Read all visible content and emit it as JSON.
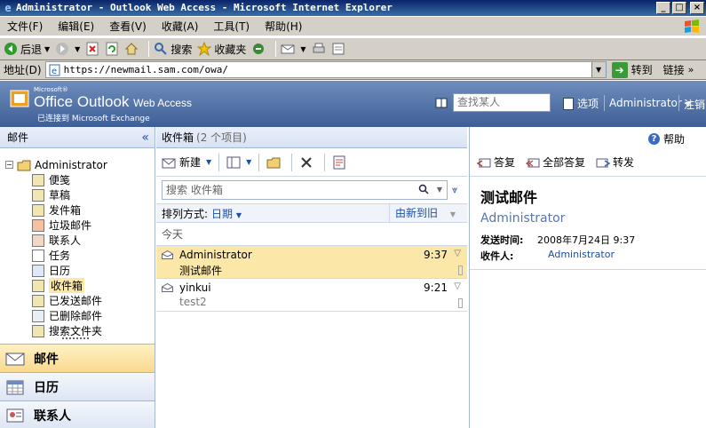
{
  "window": {
    "title": "Administrator - Outlook Web Access - Microsoft Internet Explorer",
    "buttons": {
      "minimize": "_",
      "maximize": "□",
      "close": "×"
    }
  },
  "menu": [
    "文件(F)",
    "编辑(E)",
    "查看(V)",
    "收藏(A)",
    "工具(T)",
    "帮助(H)"
  ],
  "toolbar": {
    "back": "后退",
    "search": "搜索",
    "favorites": "收藏夹"
  },
  "address": {
    "label": "地址(D)",
    "url": "https://newmail.sam.com/owa/",
    "go": "转到",
    "links": "链接",
    "links_chevron": "»"
  },
  "owa": {
    "ms_label": "Microsoft®",
    "product_office": "Office Outlook",
    "product_owa": "Web Access",
    "connected": "已连接到 Microsoft Exchange",
    "find_placeholder": "查找某人",
    "options": "选项",
    "user": "Administrator",
    "logoff": "注销"
  },
  "nav": {
    "title": "邮件",
    "collapse": "«",
    "root": "Administrator",
    "folders": [
      {
        "label": "便笺",
        "icon": "note-icon"
      },
      {
        "label": "草稿",
        "icon": "drafts-icon"
      },
      {
        "label": "发件箱",
        "icon": "outbox-icon"
      },
      {
        "label": "垃圾邮件",
        "icon": "junk-icon"
      },
      {
        "label": "联系人",
        "icon": "contacts-icon"
      },
      {
        "label": "任务",
        "icon": "tasks-icon"
      },
      {
        "label": "日历",
        "icon": "calendar-icon"
      },
      {
        "label": "收件箱",
        "icon": "inbox-icon",
        "selected": true
      },
      {
        "label": "已发送邮件",
        "icon": "sent-icon"
      },
      {
        "label": "已删除邮件",
        "icon": "deleted-icon"
      },
      {
        "label": "搜索文件夹",
        "icon": "search-folder-icon"
      }
    ],
    "modules": {
      "mail": "邮件",
      "calendar": "日历",
      "contacts": "联系人"
    }
  },
  "list": {
    "title": "收件箱",
    "count": "(2 个项目)",
    "new": "新建",
    "search_placeholder": "搜索 收件箱",
    "sort_label": "排列方式:",
    "sort_field": "日期",
    "sort_order": "由新到旧",
    "group": "今天",
    "messages": [
      {
        "from": "Administrator",
        "subject": "测试邮件",
        "time": "9:37",
        "selected": true
      },
      {
        "from": "yinkui",
        "subject": "test2",
        "time": "9:21",
        "selected": false
      }
    ]
  },
  "reading": {
    "help": "帮助",
    "reply": "答复",
    "reply_all": "全部答复",
    "forward": "转发",
    "subject": "测试邮件",
    "from": "Administrator",
    "sent_label": "发送时间:",
    "sent_value": "2008年7月24日 9:37",
    "to_label": "收件人:",
    "to_value": "Administrator"
  }
}
